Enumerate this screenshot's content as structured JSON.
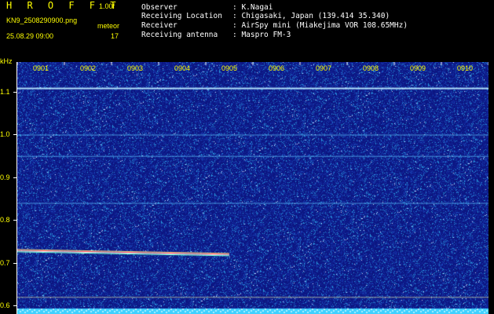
{
  "header": {
    "app_title": "H R O F F T",
    "version": "1.00f",
    "file_name": "KN9_2508290900.png",
    "meteor_label": "meteor",
    "datetime": "25.08.29 09:00",
    "meteor_count": "17",
    "info": [
      {
        "key": "Observer",
        "value": ": K.Nagai"
      },
      {
        "key": "Receiving Location",
        "value": ": Chigasaki, Japan (139.414 35.340)"
      },
      {
        "key": "Receiver",
        "value": ": AirSpy mini (Miakejima VOR 108.65MHz)"
      },
      {
        "key": "Receiving antenna",
        "value": ": Maspro FM-3"
      }
    ]
  },
  "chart_data": {
    "type": "heatmap",
    "ylabel": "kHz",
    "y_ticks": [
      "1.1",
      "1.0",
      "0.9",
      "0.8",
      "0.7",
      "0.6"
    ],
    "y_range": [
      0.58,
      1.17
    ],
    "x_ticks": [
      "0901",
      "0902",
      "0903",
      "0904",
      "0905",
      "0906",
      "0907",
      "0908",
      "0909",
      "0910"
    ],
    "x_range_minutes": [
      0.0,
      10.0
    ],
    "horizontal_lines_khz": [
      1.11,
      1.0,
      0.95,
      0.84,
      0.62
    ],
    "meteor_trail": {
      "khz": 0.73,
      "x_start_min": 0.0,
      "x_end_min": 4.5
    },
    "colors": {
      "background": "#0d1a86",
      "label": "#ffff00",
      "trace": "#ffffff"
    }
  }
}
